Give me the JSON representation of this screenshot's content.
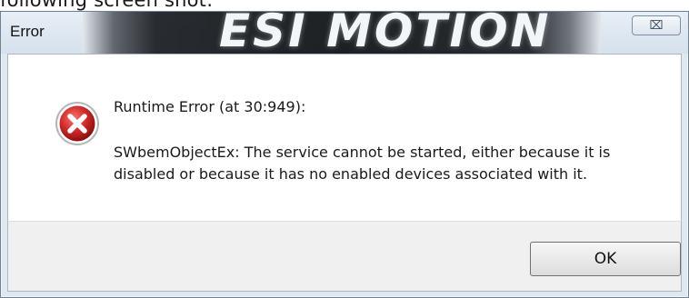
{
  "top_crop_text": "following screen shot:",
  "window": {
    "title": "Error",
    "background_banner_text": "ESI MOTION",
    "close_glyph": "⌧"
  },
  "message": {
    "icon": "error-icon",
    "title": "Runtime Error (at 30:949):",
    "body": "SWbemObjectEx: The service cannot be started, either because it is disabled or because it has no enabled devices associated with it."
  },
  "buttons": {
    "ok_label": "OK"
  },
  "colors": {
    "error_red": "#d42a2a",
    "dialog_frame": "#dfe7ef",
    "footer_bg": "#f0f0f0"
  }
}
